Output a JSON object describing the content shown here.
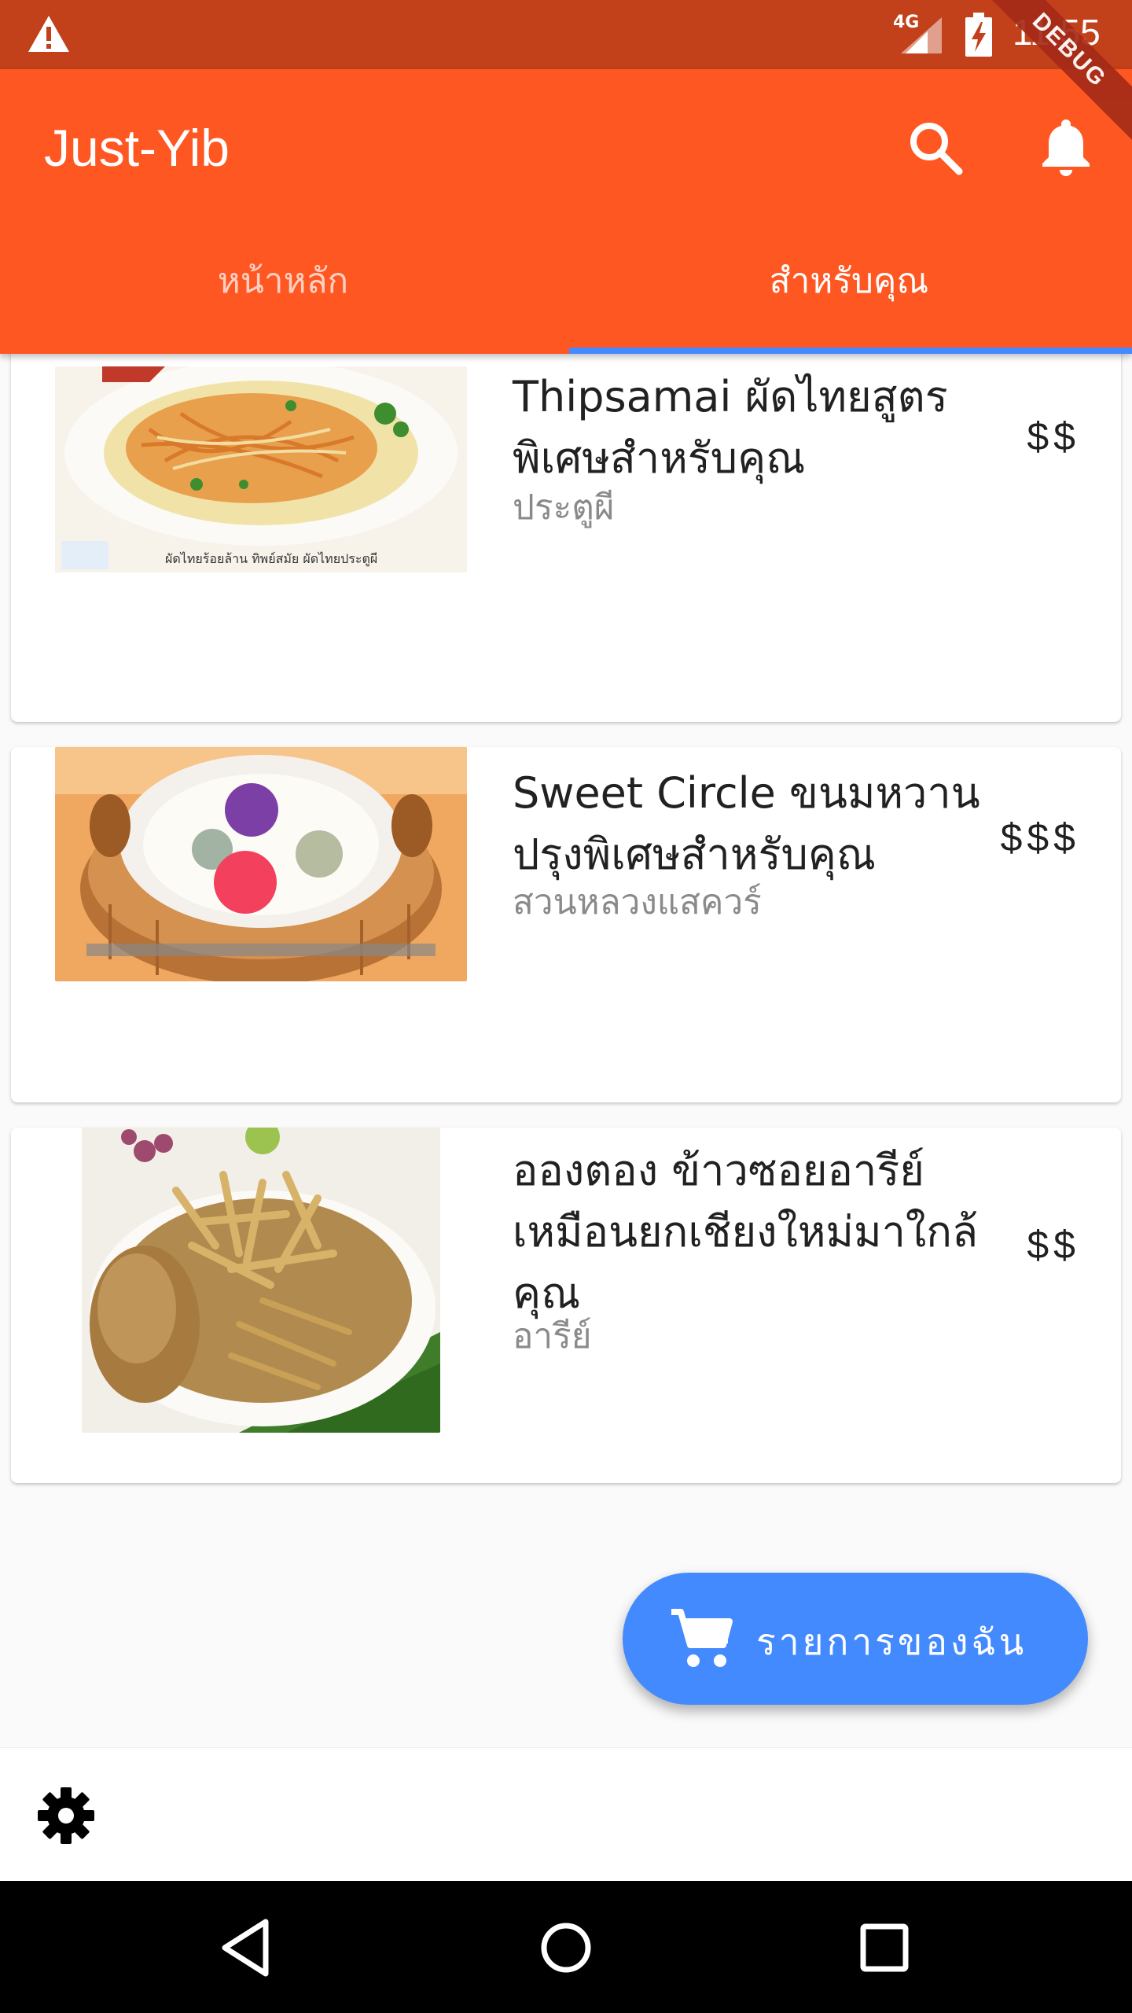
{
  "status_bar": {
    "network": "4G",
    "time": "11:55",
    "debug_label": "DEBUG"
  },
  "app_bar": {
    "title": "Just-Yib",
    "tabs": [
      {
        "label": "หน้าหลัก",
        "selected": false
      },
      {
        "label": "สำหรับคุณ",
        "selected": true
      }
    ]
  },
  "restaurants": [
    {
      "name": "Thipsamai ผัดไทยสูตรพิเศษสำหรับคุณ",
      "location": "ประตูผี",
      "price": "$$",
      "image_caption": "ผัดไทยร้อยล้าน ทิพย์สมัย ผัดไทยประตูผี"
    },
    {
      "name": "Sweet Circle ขนมหวานปรุงพิเศษสำหรับคุณ",
      "location": "สวนหลวงแสควร์",
      "price": "$$$"
    },
    {
      "name": "อองตอง ข้าวซอยอารีย์เหมือนยกเชียงใหม่มาใกล้คุณ",
      "location": "อารีย์",
      "price": "$$"
    }
  ],
  "fab": {
    "label": "รายการของฉัน"
  },
  "colors": {
    "status_bar": "#c2401a",
    "app_bar": "#ff5722",
    "accent": "#448aff"
  },
  "icons": [
    "warning-icon",
    "signal-icon",
    "battery-charging-icon",
    "search-icon",
    "bell-icon",
    "cart-icon",
    "gear-icon",
    "back-icon",
    "home-icon",
    "recents-icon"
  ]
}
